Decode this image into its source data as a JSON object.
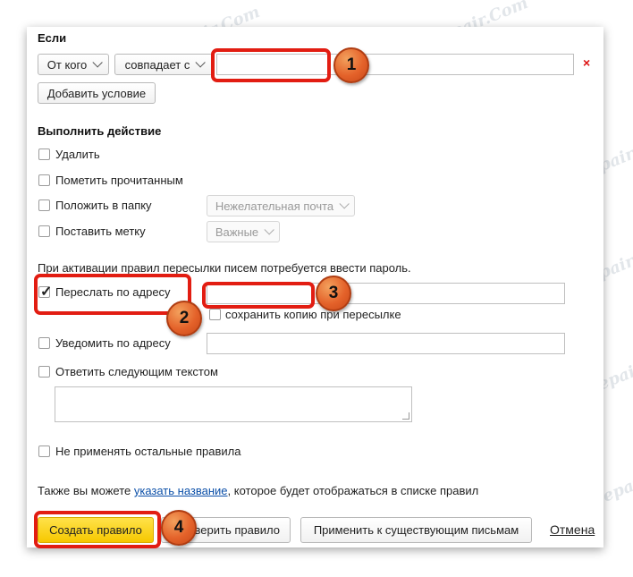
{
  "conditions": {
    "heading": "Если",
    "field_select": "От кого",
    "operator_select": "совпадает с",
    "value_input": "",
    "remove_symbol": "×",
    "add_condition_label": "Добавить условие"
  },
  "actions": {
    "heading": "Выполнить действие",
    "delete_label": "Удалить",
    "mark_read_label": "Пометить прочитанным",
    "move_folder_label": "Положить в папку",
    "folder_select": "Нежелательная почта",
    "set_tag_label": "Поставить метку",
    "tag_select": "Важные"
  },
  "forwarding": {
    "notice": "При активации правил пересылки писем потребуется ввести пароль.",
    "forward_label": "Переслать по адресу",
    "forward_checked": true,
    "forward_address": "",
    "keep_copy_label": "сохранить копию при пересылке",
    "notify_label": "Уведомить по адресу",
    "notify_address": "",
    "reply_label": "Ответить следующим текстом",
    "reply_text": ""
  },
  "options": {
    "no_other_rules_label": "Не применять остальные правила"
  },
  "footer": {
    "name_hint_before": "Также вы можете ",
    "name_hint_link": "указать название",
    "name_hint_after": ", которое будет отображаться в списке правил",
    "create_button": "Создать правило",
    "check_button": "Проверить правило",
    "check_button_visible": "верить правило",
    "apply_button": "Применить к существующим письмам",
    "cancel_link": "Отмена"
  },
  "annotations": {
    "badge_1": "1",
    "badge_2": "2",
    "badge_3": "3",
    "badge_4": "4",
    "highlight_color": "#e21d12",
    "badge_color": "#e4622a"
  },
  "watermark": "Soringpcrepair.Com",
  "colors": {
    "primary_button": "#f6c800",
    "link": "#0b4fa8",
    "remove": "#dd1111"
  }
}
